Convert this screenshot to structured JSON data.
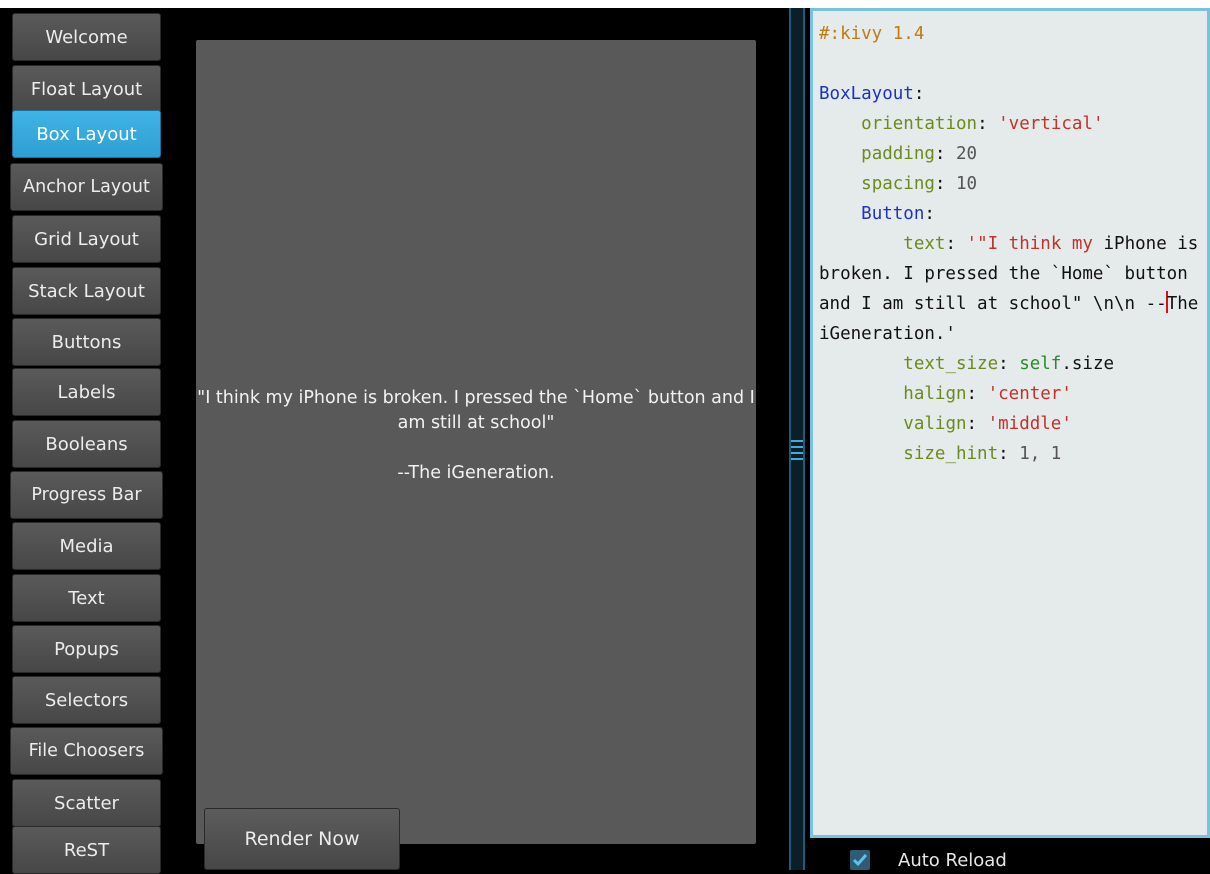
{
  "sidebar": {
    "items": [
      {
        "label": "Welcome",
        "active": false
      },
      {
        "label": "Float Layout",
        "active": false
      },
      {
        "label": "Box Layout",
        "active": true
      },
      {
        "label": "Anchor Layout",
        "active": false
      },
      {
        "label": "Grid Layout",
        "active": false
      },
      {
        "label": "Stack Layout",
        "active": false
      },
      {
        "label": "Buttons",
        "active": false
      },
      {
        "label": "Labels",
        "active": false
      },
      {
        "label": "Booleans",
        "active": false
      },
      {
        "label": "Progress Bar",
        "active": false
      },
      {
        "label": "Media",
        "active": false
      },
      {
        "label": "Text",
        "active": false
      },
      {
        "label": "Popups",
        "active": false
      },
      {
        "label": "Selectors",
        "active": false
      },
      {
        "label": "File Choosers",
        "active": false
      },
      {
        "label": "Scatter",
        "active": false
      },
      {
        "label": "ReST",
        "active": false
      }
    ]
  },
  "preview": {
    "text": "\"I think my iPhone is broken. I pressed the `Home` button and I am still at school\"\n\n--The iGeneration."
  },
  "editor": {
    "header": "#:kivy 1.4",
    "root": "BoxLayout",
    "orientation_key": "orientation",
    "orientation_val": "'vertical'",
    "padding_key": "padding",
    "padding_val": "20",
    "spacing_key": "spacing",
    "spacing_val": "10",
    "child": "Button",
    "text_key": "text",
    "text_val_start": "'\"I think my",
    "text_val_wrap1": "iPhone is broken. I pressed the `Home` button and I am still at school\" \\n\\n --",
    "text_val_wrap2": "The iGeneration.'",
    "text_size_key": "text_size",
    "text_size_self": "self",
    "text_size_attr": ".size",
    "halign_key": "halign",
    "halign_val": "'center'",
    "valign_key": "valign",
    "valign_val": "'middle'",
    "size_hint_key": "size_hint",
    "size_hint_val": "1, 1"
  },
  "footer": {
    "auto_reload_label": "Auto Reload",
    "auto_reload_checked": true,
    "render_button": "Render Now"
  },
  "colors": {
    "active_tab": "#3fb4e6",
    "editor_bg": "#e5eaea",
    "editor_border": "#78c2e0"
  }
}
